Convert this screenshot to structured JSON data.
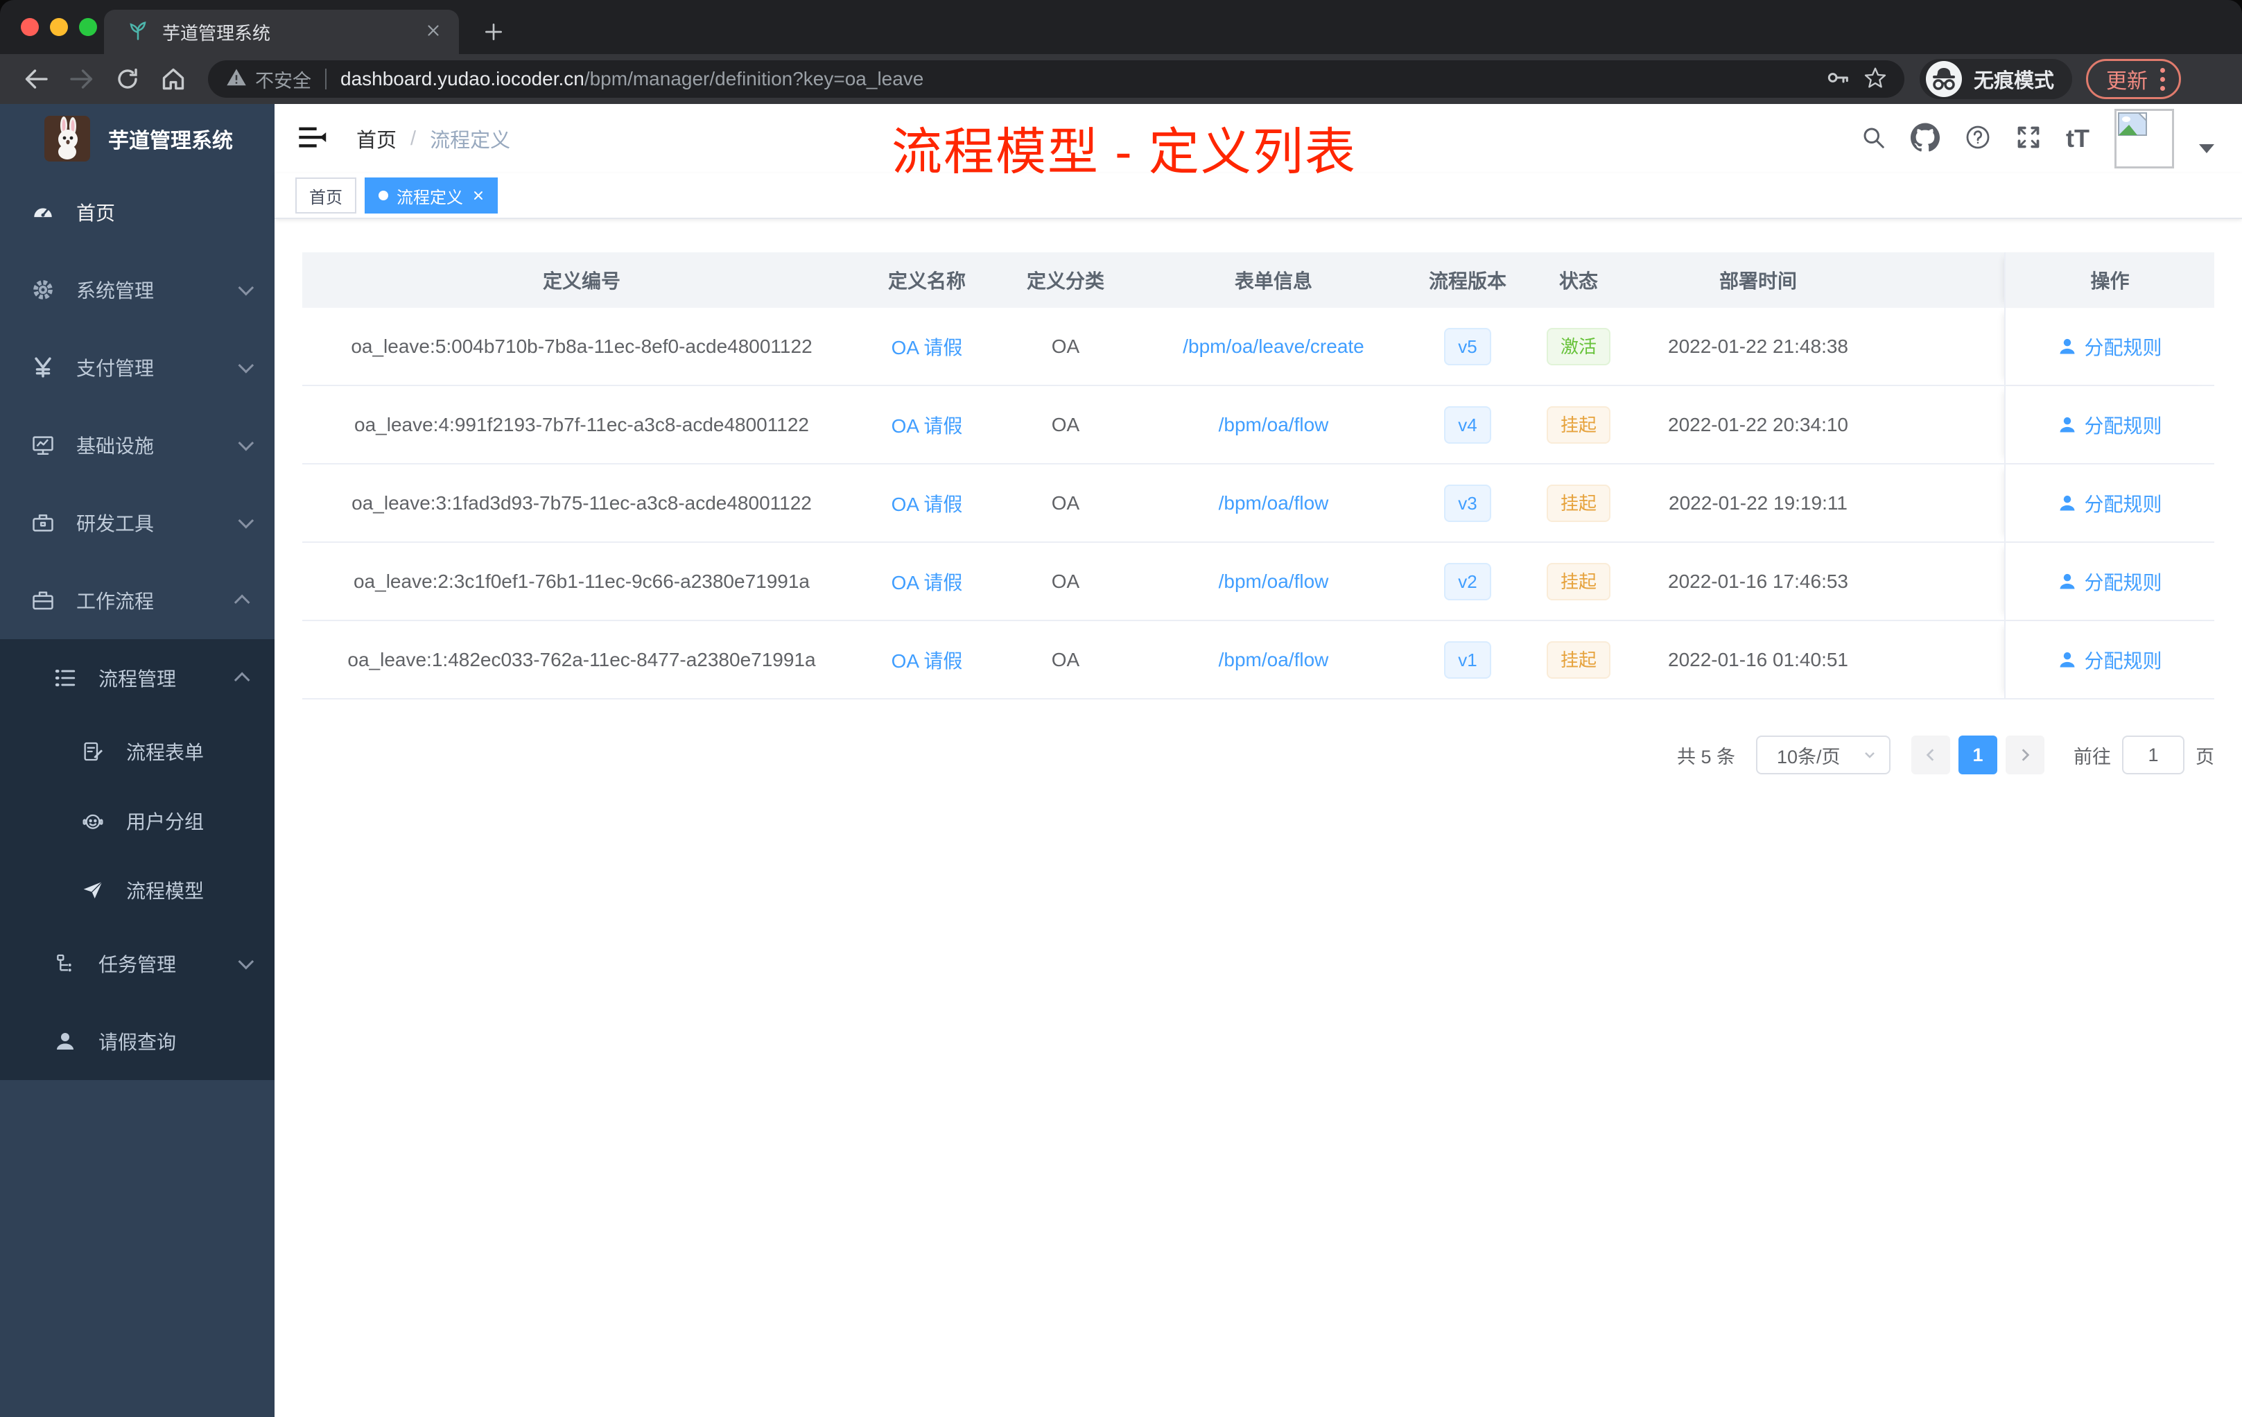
{
  "browser": {
    "tab_title": "芋道管理系统",
    "security_label": "不安全",
    "url_host": "dashboard.yudao.iocoder.cn",
    "url_path": "/bpm/manager/definition?key=oa_leave",
    "incognito_label": "无痕模式",
    "update_label": "更新"
  },
  "sidebar": {
    "app_title": "芋道管理系统",
    "items": [
      {
        "label": "首页",
        "icon": "dashboard-icon"
      },
      {
        "label": "系统管理",
        "icon": "gear-icon",
        "chevron": "down"
      },
      {
        "label": "支付管理",
        "icon": "yen-icon",
        "chevron": "down"
      },
      {
        "label": "基础设施",
        "icon": "monitor-icon",
        "chevron": "down"
      },
      {
        "label": "研发工具",
        "icon": "toolbox-icon",
        "chevron": "down"
      },
      {
        "label": "工作流程",
        "icon": "briefcase-icon",
        "chevron": "up"
      },
      {
        "label": "流程管理",
        "icon": "list-tree-icon",
        "chevron": "up"
      },
      {
        "label": "流程表单",
        "icon": "form-edit-icon"
      },
      {
        "label": "用户分组",
        "icon": "robot-icon"
      },
      {
        "label": "流程模型",
        "icon": "paper-plane-icon"
      },
      {
        "label": "任务管理",
        "icon": "org-tree-icon",
        "chevron": "down"
      },
      {
        "label": "请假查询",
        "icon": "user-icon"
      }
    ]
  },
  "navbar": {
    "breadcrumb_home": "首页",
    "breadcrumb_separator": "/",
    "breadcrumb_current": "流程定义",
    "annotation": "流程模型 - 定义列表",
    "font_size_glyph": "tT"
  },
  "tags": {
    "home": "首页",
    "current": "流程定义"
  },
  "table": {
    "columns": [
      "定义编号",
      "定义名称",
      "定义分类",
      "表单信息",
      "流程版本",
      "状态",
      "部署时间",
      "操作"
    ],
    "rows": [
      {
        "id": "oa_leave:5:004b710b-7b8a-11ec-8ef0-acde48001122",
        "name": "OA 请假",
        "category": "OA",
        "form": "/bpm/oa/leave/create",
        "version": "v5",
        "status": "激活",
        "status_type": "active",
        "deploy_time": "2022-01-22 21:48:38",
        "action": "分配规则"
      },
      {
        "id": "oa_leave:4:991f2193-7b7f-11ec-a3c8-acde48001122",
        "name": "OA 请假",
        "category": "OA",
        "form": "/bpm/oa/flow",
        "version": "v4",
        "status": "挂起",
        "status_type": "suspend",
        "deploy_time": "2022-01-22 20:34:10",
        "action": "分配规则"
      },
      {
        "id": "oa_leave:3:1fad3d93-7b75-11ec-a3c8-acde48001122",
        "name": "OA 请假",
        "category": "OA",
        "form": "/bpm/oa/flow",
        "version": "v3",
        "status": "挂起",
        "status_type": "suspend",
        "deploy_time": "2022-01-22 19:19:11",
        "action": "分配规则"
      },
      {
        "id": "oa_leave:2:3c1f0ef1-76b1-11ec-9c66-a2380e71991a",
        "name": "OA 请假",
        "category": "OA",
        "form": "/bpm/oa/flow",
        "version": "v2",
        "status": "挂起",
        "status_type": "suspend",
        "deploy_time": "2022-01-16 17:46:53",
        "action": "分配规则"
      },
      {
        "id": "oa_leave:1:482ec033-762a-11ec-8477-a2380e71991a",
        "name": "OA 请假",
        "category": "OA",
        "form": "/bpm/oa/flow",
        "version": "v1",
        "status": "挂起",
        "status_type": "suspend",
        "deploy_time": "2022-01-16 01:40:51",
        "action": "分配规则"
      }
    ]
  },
  "pagination": {
    "total": "共 5 条",
    "page_size": "10条/页",
    "current_page": "1",
    "goto_prefix": "前往",
    "goto_value": "1",
    "goto_suffix": "页"
  },
  "colors": {
    "accent": "#409eff",
    "annotation_red": "#ff2600",
    "status_active_green": "#67c23a",
    "status_suspended_orange": "#e6a23c",
    "version_badge_blue": "#409eff",
    "sidebar_bg": "#304156",
    "submenu_bg": "#1f2d3d",
    "update_salmon": "#f28b82",
    "tab_active_blue": "#409eff"
  }
}
